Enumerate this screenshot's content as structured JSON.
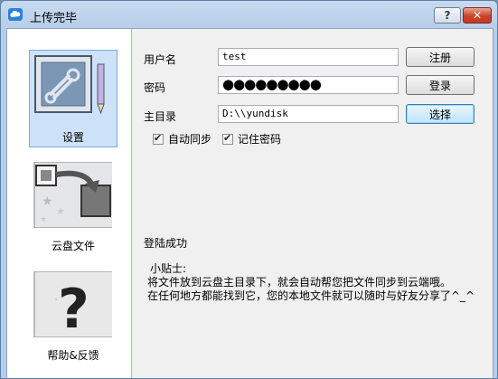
{
  "window": {
    "title": "上传完毕",
    "help_label": "?",
    "close_label": "✕"
  },
  "sidebar": {
    "items": [
      {
        "label": "设置",
        "icon": "settings-tools-icon",
        "selected": true
      },
      {
        "label": "云盘文件",
        "icon": "cloud-files-icon",
        "selected": false
      },
      {
        "label": "帮助&反馈",
        "icon": "help-question-icon",
        "selected": false
      }
    ]
  },
  "form": {
    "username": {
      "label": "用户名",
      "value": "test"
    },
    "password": {
      "label": "密码",
      "value": "●●●●●●●●●"
    },
    "homedir": {
      "label": "主目录",
      "value": "D:\\\\yundisk"
    },
    "register_label": "注册",
    "login_label": "登录",
    "browse_label": "选择",
    "autosync": {
      "label": "自动同步",
      "checked": true
    },
    "remember": {
      "label": "记住密码",
      "checked": true
    }
  },
  "status": "登陆成功",
  "tips": {
    "title": "小贴士:",
    "line1": "将文件放到云盘主目录下，就会自动帮您把文件同步到云端哦。",
    "line2": "在任何地方都能找到它，您的本地文件就可以随时与好友分享了^_^"
  },
  "colors": {
    "titlebar": "#b8cde9",
    "selected_bg": "#cde2f8",
    "close_button": "#c8432b"
  }
}
